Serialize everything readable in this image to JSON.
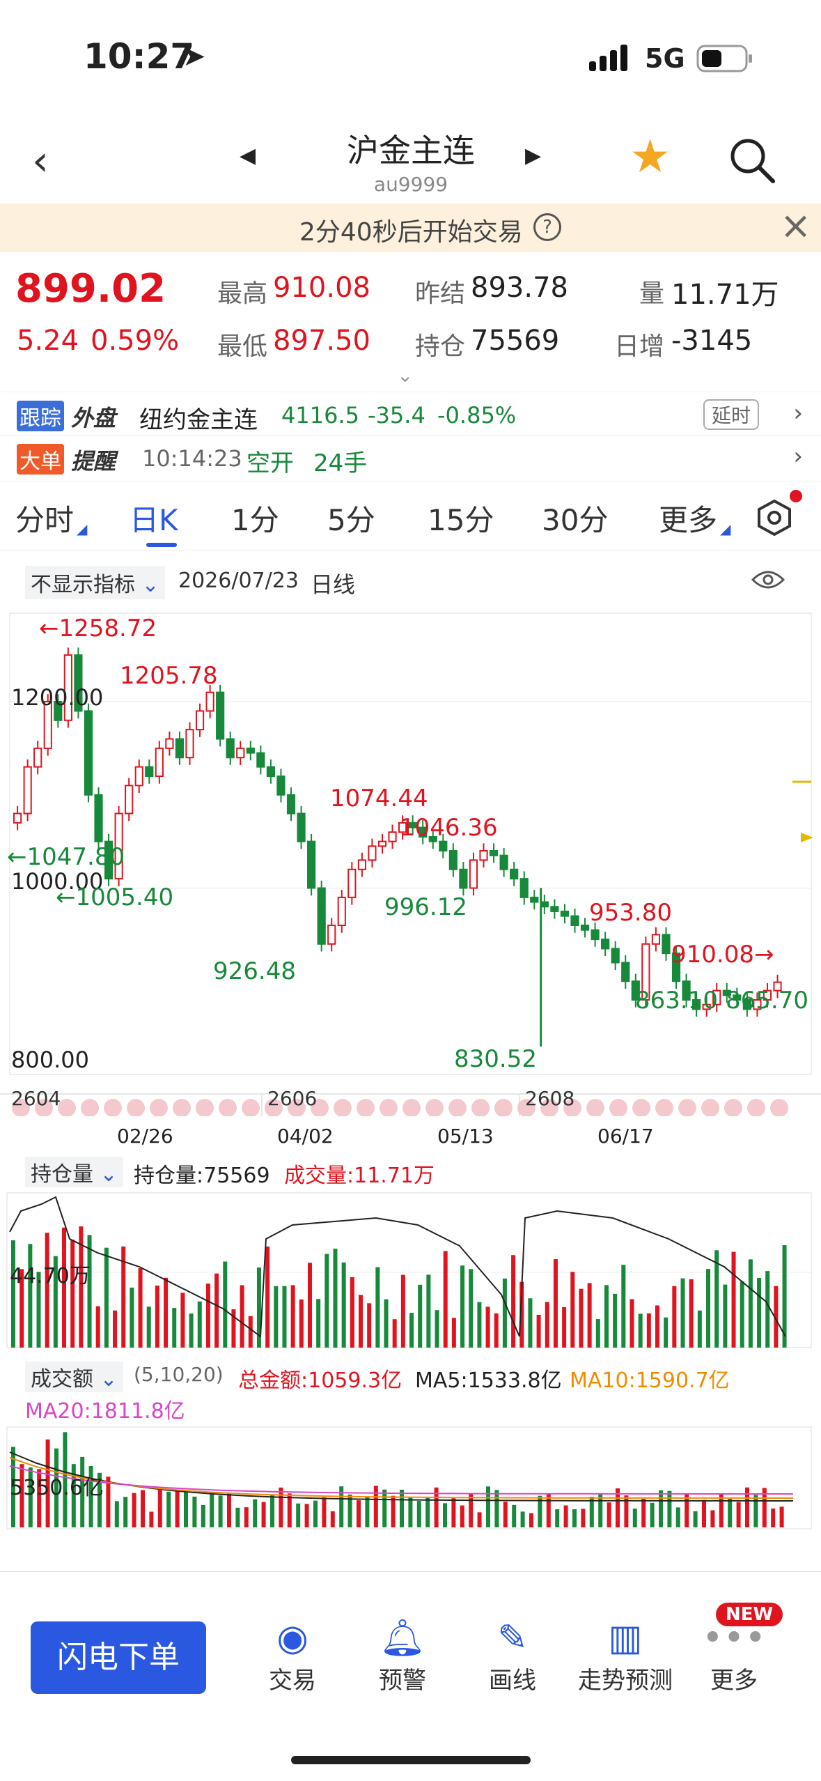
{
  "status": {
    "time": "10:27",
    "network": "5G"
  },
  "nav": {
    "title": "沪金主连",
    "code": "au9999"
  },
  "banner": {
    "text": "2分40秒后开始交易",
    "help": "?",
    "close": "×"
  },
  "quote": {
    "price": "899.02",
    "change": "5.24",
    "change_pct": "0.59%",
    "high_label": "最高",
    "high": "910.08",
    "low_label": "最低",
    "low": "897.50",
    "prev_label": "昨结",
    "prev": "893.78",
    "oi_label": "持仓",
    "oi": "75569",
    "vol_label": "量",
    "vol": "11.71万",
    "daily_label": "日增",
    "daily": "-3145"
  },
  "ext": {
    "tag1": "跟踪",
    "tag2": "外盘",
    "name": "纽约金主连",
    "price": "4116.5",
    "change": "-35.4",
    "pct": "-0.85%",
    "delay": "延时"
  },
  "alert": {
    "tag1": "大单",
    "tag2": "提醒",
    "time": "10:14:23",
    "action": "空开",
    "qty": "24手"
  },
  "tabs": [
    "分时",
    "日K",
    "1分",
    "5分",
    "15分",
    "30分",
    "更多"
  ],
  "chart_header": {
    "indicator": "不显示指标",
    "date": "2026/07/23",
    "period": "日线"
  },
  "chart_labels": {
    "y1200": "1200.00",
    "y1000": "1000.00",
    "y800": "800.00",
    "peaks": [
      "←1258.72",
      "1205.78",
      "←1047.80",
      "←1005.40",
      "1074.44",
      "1046.36",
      "996.12",
      "926.48",
      "830.52",
      "953.80",
      "910.08→",
      "863.10",
      "865.70"
    ],
    "contracts": [
      "2604",
      "2606",
      "2608"
    ],
    "dates": [
      "02/26",
      "04/02",
      "05/13",
      "06/17"
    ]
  },
  "oi_panel": {
    "selector": "持仓量",
    "oi_text": "持仓量:75569",
    "vol_text": "成交量:11.71万",
    "axis": "44.70万"
  },
  "amt_panel": {
    "selector": "成交额",
    "params": "(5,10,20)",
    "total": "总金额:1059.3亿",
    "ma5": "MA5:1533.8亿",
    "ma10": "MA10:1590.7亿",
    "ma20": "MA20:1811.8亿",
    "axis": "5350.6亿"
  },
  "bottom": {
    "order_button": "闪电下单",
    "tools": [
      "交易",
      "预警",
      "画线",
      "走势预测",
      "更多"
    ],
    "new_badge": "NEW"
  },
  "colors": {
    "up": "#e0141e",
    "down": "#17893a",
    "accent": "#2a58e0",
    "banner": "#fdf0dc",
    "star": "#f5a623"
  },
  "chart_data": {
    "type": "candlestick",
    "title": "沪金主连 日线",
    "ylim": [
      800,
      1280
    ],
    "close_series": [
      1080,
      1130,
      1150,
      1200,
      1180,
      1250,
      1190,
      1100,
      1050,
      1010,
      1080,
      1110,
      1130,
      1120,
      1150,
      1160,
      1140,
      1170,
      1190,
      1210,
      1160,
      1140,
      1150,
      1145,
      1130,
      1120,
      1100,
      1080,
      1050,
      1000,
      940,
      960,
      990,
      1020,
      1030,
      1045,
      1050,
      1060,
      1070,
      1065,
      1055,
      1050,
      1040,
      1020,
      1000,
      1030,
      1040,
      1035,
      1020,
      1010,
      990,
      985,
      980,
      975,
      970,
      960,
      955,
      945,
      935,
      920,
      900,
      880,
      940,
      950,
      930,
      900,
      880,
      870,
      875,
      890,
      885,
      880,
      870,
      880,
      890,
      899
    ],
    "annotations": [
      "1258.72",
      "1205.78",
      "1074.44",
      "1046.36",
      "953.80",
      "910.08",
      "1047.80",
      "1005.40",
      "996.12",
      "926.48",
      "830.52",
      "863.10",
      "865.70"
    ]
  }
}
